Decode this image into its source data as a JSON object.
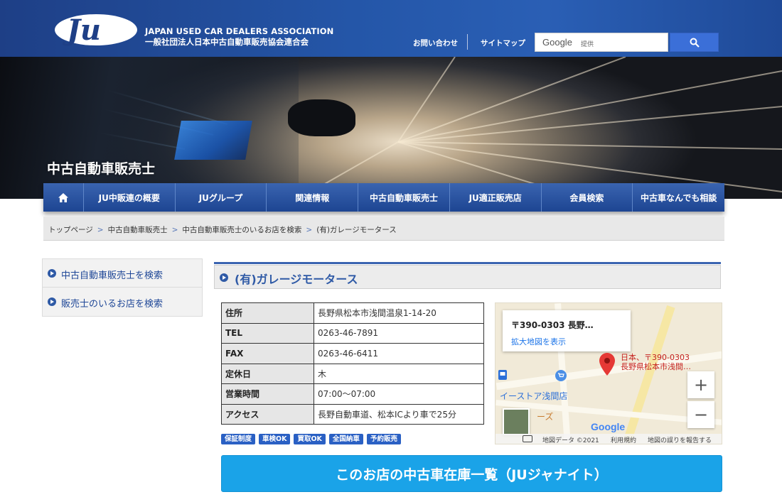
{
  "header": {
    "assoc_en": "JAPAN USED CAR DEALERS ASSOCIATION",
    "assoc_ja": "一般社団法人日本中古自動車販売協会連合会",
    "links": {
      "contact": "お問い合わせ",
      "sitemap": "サイトマップ"
    },
    "search": {
      "logo": "Google",
      "sub": "提供"
    }
  },
  "hero": {
    "title": "中古自動車販売士"
  },
  "nav": {
    "home_icon": "home-icon",
    "items": [
      "JU中販連の概要",
      "JUグループ",
      "関連情報",
      "中古自動車販売士",
      "JU適正販売店",
      "会員検索",
      "中古車なんでも相談"
    ]
  },
  "breadcrumb": [
    "トップページ",
    "中古自動車販売士",
    "中古自動車販売士のいるお店を検索",
    "(有)ガレージモータース"
  ],
  "breadcrumb_sep": ">",
  "sidebar": {
    "items": [
      "中古自動車販売士を検索",
      "販売士のいるお店を検索"
    ]
  },
  "shop": {
    "name": "(有)ガレージモータース",
    "info": [
      {
        "key": "住所",
        "value": "長野県松本市浅間温泉1-14-20"
      },
      {
        "key": "TEL",
        "value": "0263-46-7891"
      },
      {
        "key": "FAX",
        "value": "0263-46-6411"
      },
      {
        "key": "定休日",
        "value": "木"
      },
      {
        "key": "営業時間",
        "value": "07:00〜07:00"
      },
      {
        "key": "アクセス",
        "value": "長野自動車道、松本ICより車で25分"
      }
    ],
    "tags": [
      "保証制度",
      "車検OK",
      "買取OK",
      "全国納車",
      "予約販売"
    ]
  },
  "map": {
    "card_address": "〒390-0303 長野…",
    "card_link": "拡大地図を表示",
    "pin_label_1": "日本、〒390-0303",
    "pin_label_2": "長野県松本市浅間…",
    "poi_1": "イーストア浅間店",
    "poi_2": "ーズ",
    "google": "Google",
    "footer": {
      "data": "地図データ ©2021",
      "terms": "利用規約",
      "report": "地図の誤りを報告する"
    }
  },
  "cta": {
    "label": "このお店の中古車在庫一覧（JUジャナイト）"
  },
  "colors": {
    "brand_blue": "#1e3f86",
    "nav_blue": "#2a56a4",
    "cta": "#1aa3e8",
    "tag": "#2a60c4"
  }
}
